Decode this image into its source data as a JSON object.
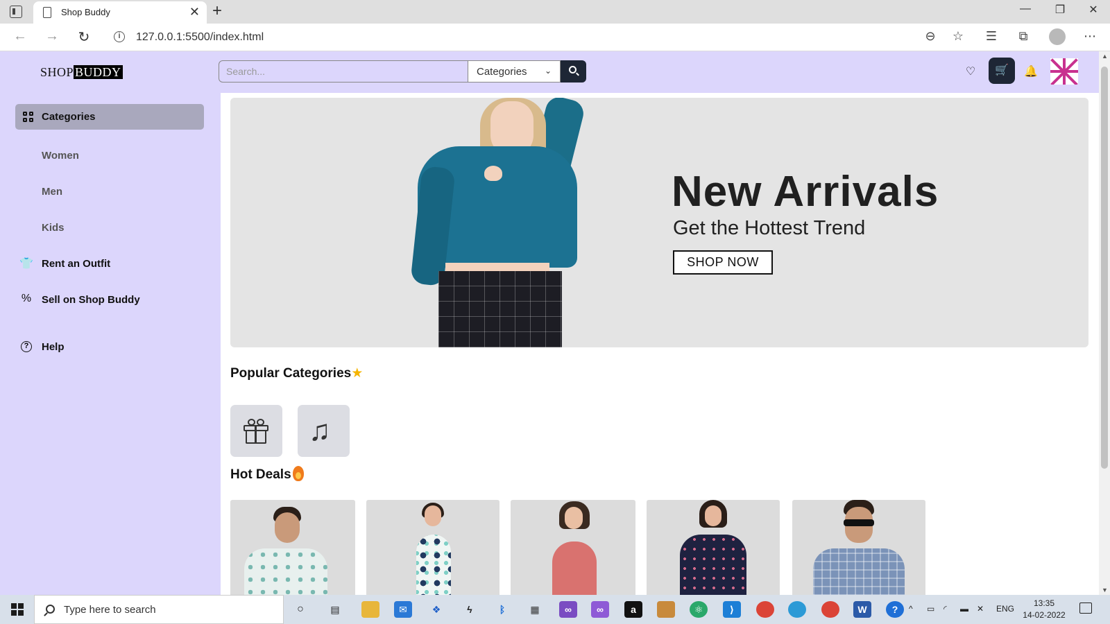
{
  "browser": {
    "tab_title": "Shop Buddy",
    "tab_close": "✕",
    "new_tab": "+",
    "url": "127.0.0.1:5500/index.html",
    "window_controls": {
      "minimize": "—",
      "maximize": "❐",
      "close": "✕"
    }
  },
  "header": {
    "logo_shop": "SHOP",
    "logo_buddy": "BUDDY",
    "search_placeholder": "Search...",
    "category_select": "Categories"
  },
  "sidebar": {
    "active_label": "Categories",
    "sub_items": [
      "Women",
      "Men",
      "Kids"
    ],
    "rent_label": "Rent an Outfit",
    "sell_label": "Sell on Shop Buddy",
    "help_label": "Help"
  },
  "banner": {
    "title": "New Arrivals",
    "subtitle": "Get the Hottest Trend",
    "button": "SHOP NOW"
  },
  "sections": {
    "popular": "Popular Categories",
    "hot_deals": "Hot Deals"
  },
  "taskbar": {
    "search_placeholder": "Type here to search",
    "language": "ENG",
    "time": "13:35",
    "date": "14-02-2022"
  },
  "colors": {
    "page_bg": "#dcd6fc",
    "dark_button": "#1e2635",
    "sidebar_active": "#a9a8bd",
    "banner_bg": "#e4e4e4",
    "accent_star": "#f5b400"
  }
}
